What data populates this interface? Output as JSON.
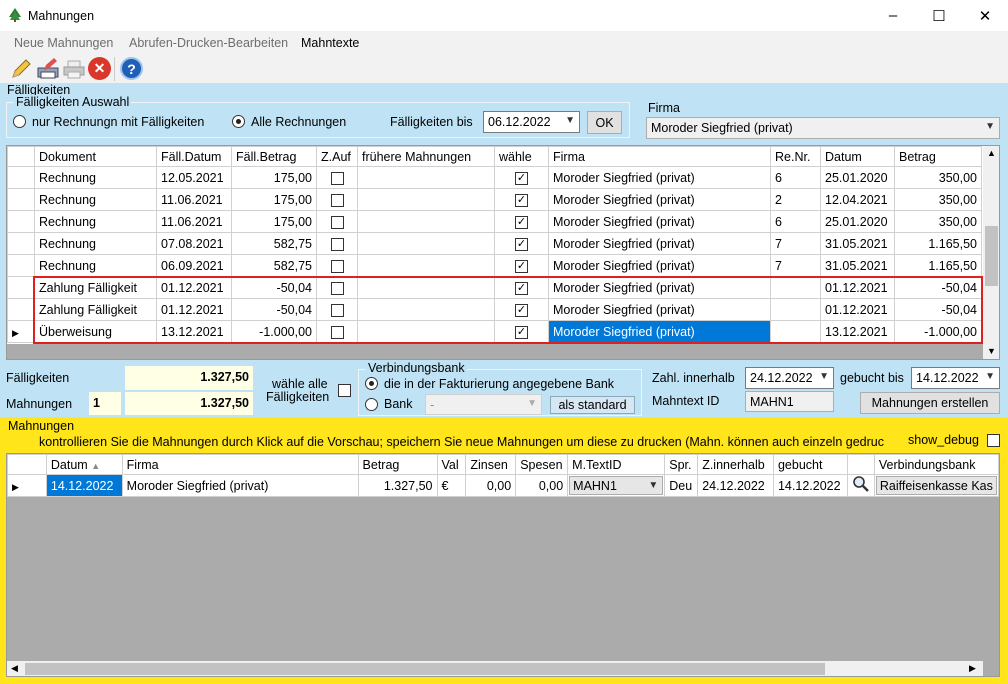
{
  "window": {
    "title": "Mahnungen",
    "minimize": "–",
    "maximize": "☐",
    "close": "✕"
  },
  "menu": [
    "Neue Mahnungen",
    "Abrufen-Drucken-Bearbeiten",
    "Mahntexte"
  ],
  "toolbar": [
    {
      "icon": "pencil-icon"
    },
    {
      "icon": "edit-print-icon"
    },
    {
      "icon": "printer-icon"
    },
    {
      "icon": "delete-icon",
      "glyph": "✕"
    },
    {
      "icon": "help-icon",
      "glyph": "?"
    }
  ],
  "faelligkeiten": {
    "section_label": "Fälligkeiten",
    "group_label": "Fälligkeiten Auswahl",
    "radio_only": "nur Rechnungn mit Fälligkeiten",
    "radio_all": "Alle Rechnungen",
    "until_label": "Fälligkeiten bis",
    "until_value": "06.12.2022",
    "ok_label": "OK",
    "firma_label": "Firma",
    "firma_value": "Moroder Siegfried (privat)"
  },
  "top_table": {
    "headers": [
      "Dokument",
      "Fäll.Datum",
      "Fäll.Betrag",
      "Z.Auf",
      "frühere Mahnungen",
      "wähle",
      "Firma",
      "Re.Nr.",
      "Datum",
      "Betrag"
    ],
    "rows": [
      {
        "dok": "Rechnung",
        "fdat": "12.05.2021",
        "fbet": "175,00",
        "zauf": false,
        "frueher": "",
        "waehle": true,
        "firma": "Moroder Siegfried (privat)",
        "renr": "6",
        "datum": "25.01.2020",
        "betrag": "350,00"
      },
      {
        "dok": "Rechnung",
        "fdat": "11.06.2021",
        "fbet": "175,00",
        "zauf": false,
        "frueher": "",
        "waehle": true,
        "firma": "Moroder Siegfried (privat)",
        "renr": "2",
        "datum": "12.04.2021",
        "betrag": "350,00"
      },
      {
        "dok": "Rechnung",
        "fdat": "11.06.2021",
        "fbet": "175,00",
        "zauf": false,
        "frueher": "",
        "waehle": true,
        "firma": "Moroder Siegfried (privat)",
        "renr": "6",
        "datum": "25.01.2020",
        "betrag": "350,00"
      },
      {
        "dok": "Rechnung",
        "fdat": "07.08.2021",
        "fbet": "582,75",
        "zauf": false,
        "frueher": "",
        "waehle": true,
        "firma": "Moroder Siegfried (privat)",
        "renr": "7",
        "datum": "31.05.2021",
        "betrag": "1.165,50"
      },
      {
        "dok": "Rechnung",
        "fdat": "06.09.2021",
        "fbet": "582,75",
        "zauf": false,
        "frueher": "",
        "waehle": true,
        "firma": "Moroder Siegfried (privat)",
        "renr": "7",
        "datum": "31.05.2021",
        "betrag": "1.165,50"
      },
      {
        "dok": "Zahlung Fälligkeit",
        "fdat": "01.12.2021",
        "fbet": "-50,04",
        "zauf": false,
        "frueher": "",
        "waehle": true,
        "firma": "Moroder Siegfried (privat)",
        "renr": "",
        "datum": "01.12.2021",
        "betrag": "-50,04"
      },
      {
        "dok": "Zahlung Fälligkeit",
        "fdat": "01.12.2021",
        "fbet": "-50,04",
        "zauf": false,
        "frueher": "",
        "waehle": true,
        "firma": "Moroder Siegfried (privat)",
        "renr": "",
        "datum": "01.12.2021",
        "betrag": "-50,04"
      },
      {
        "dok": "Überweisung",
        "fdat": "13.12.2021",
        "fbet": "-1.000,00",
        "zauf": false,
        "frueher": "",
        "waehle": true,
        "firma": "Moroder Siegfried (privat)",
        "renr": "",
        "datum": "13.12.2021",
        "betrag": "-1.000,00",
        "current": true
      }
    ]
  },
  "summary": {
    "faell_label": "Fälligkeiten",
    "faell_value": "1.327,50",
    "mahn_label": "Mahnungen",
    "mahn_count": "1",
    "mahn_value": "1.327,50",
    "select_all_label_1": "wähle alle",
    "select_all_label_2": "Fälligkeiten",
    "bank_group": "Verbindungsbank",
    "bank_radio1": "die in der Fakturierung angegebene Bank",
    "bank_radio2": "Bank",
    "bank_value": "-",
    "std_button": "als standard",
    "zahl_label": "Zahl. innerhalb",
    "zahl_value": "24.12.2022",
    "gebucht_label": "gebucht bis",
    "gebucht_value": "14.12.2022",
    "mahntext_label": "Mahntext ID",
    "mahntext_value": "MAHN1",
    "create_button": "Mahnungen erstellen"
  },
  "mahnungen": {
    "section_label": "Mahnungen",
    "hint": "kontrollieren Sie die Mahnungen durch Klick auf die Vorschau; speichern Sie neue Mahnungen um diese zu drucken (Mahn. können auch einzeln gedruc",
    "debug_label": "show_debug",
    "headers": [
      "Datum",
      "Firma",
      "Betrag",
      "Val",
      "Zinsen",
      "Spesen",
      "M.TextID",
      "Spr.",
      "Z.innerhalb",
      "gebucht",
      "Verbindungsbank"
    ],
    "rows": [
      {
        "datum": "14.12.2022",
        "firma": "Moroder Siegfried (privat)",
        "betrag": "1.327,50",
        "val": "€",
        "zinsen": "0,00",
        "spesen": "0,00",
        "mtext": "MAHN1",
        "spr": "Deu",
        "zinn": "24.12.2022",
        "gebucht": "14.12.2022",
        "bank": "Raiffeisenkasse Kas"
      }
    ]
  }
}
